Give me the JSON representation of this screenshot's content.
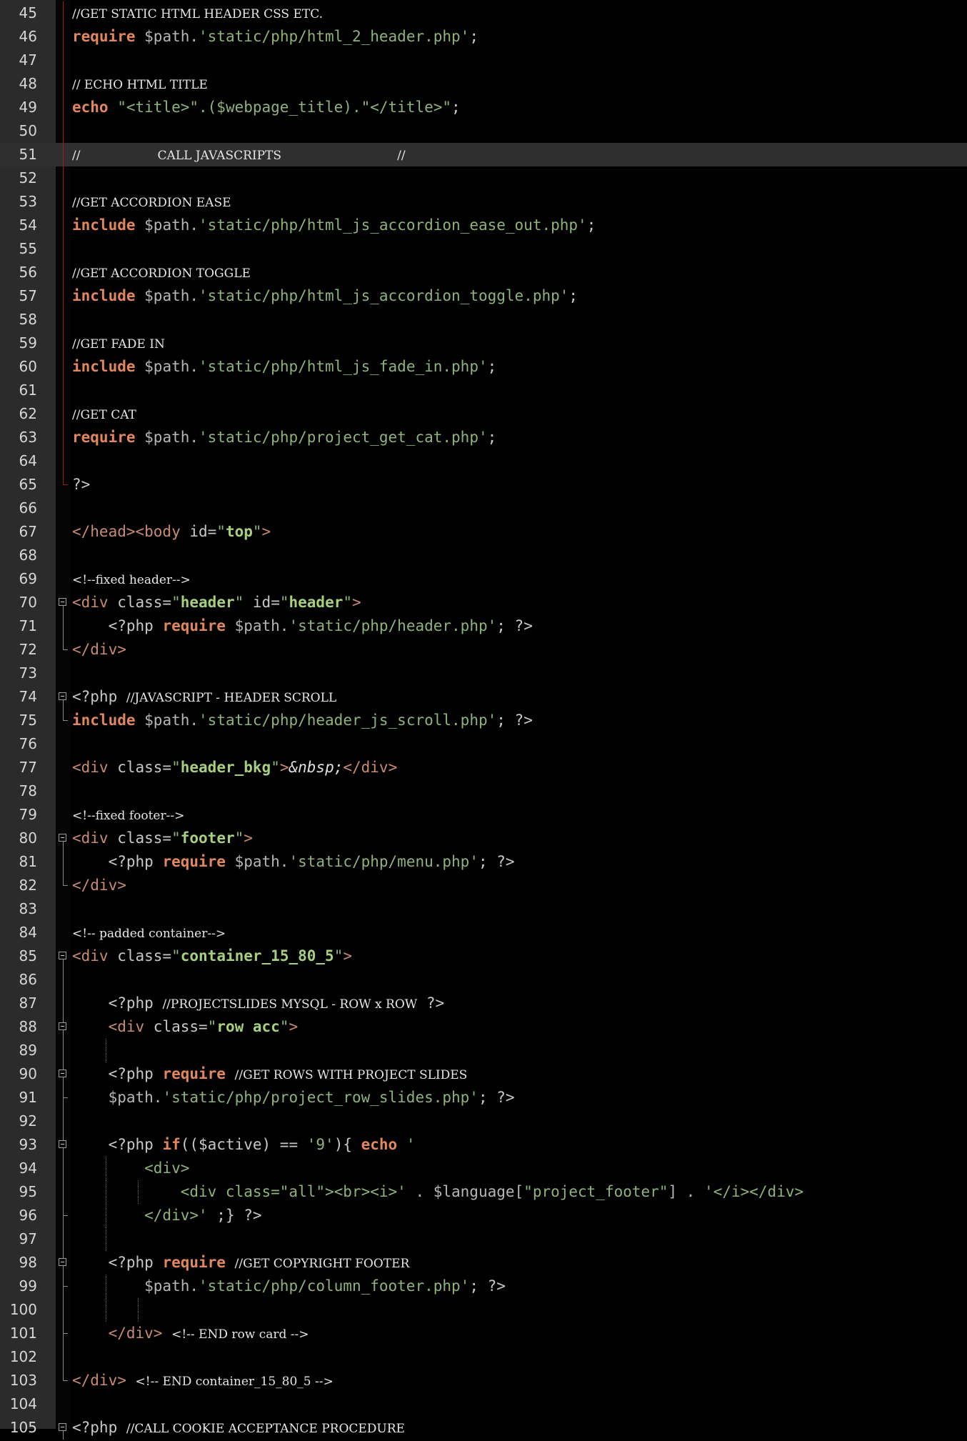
{
  "editor": {
    "colors": {
      "background": "#000000",
      "gutter": "#2b2b2b",
      "keyword": "#e0875f",
      "string": "#8fb27a",
      "tag": "#c98a73",
      "change_marker": "#a11b1b"
    },
    "lines": [
      {
        "num": "45",
        "fold": "red",
        "tokens": [
          {
            "t": "//GET STATIC HTML HEADER CSS ETC.",
            "c": "cmt"
          }
        ]
      },
      {
        "num": "46",
        "fold": "red",
        "tokens": [
          {
            "t": "require",
            "c": "kw"
          },
          {
            "t": " $path.",
            "c": "var"
          },
          {
            "t": "'static/php/html_2_header.php'",
            "c": "str"
          },
          {
            "t": ";",
            "c": "plain"
          }
        ]
      },
      {
        "num": "47",
        "fold": "red",
        "tokens": []
      },
      {
        "num": "48",
        "fold": "red",
        "tokens": [
          {
            "t": "// ECHO HTML TITLE",
            "c": "cmt"
          }
        ]
      },
      {
        "num": "49",
        "fold": "red",
        "tokens": [
          {
            "t": "echo",
            "c": "kw"
          },
          {
            "t": " \"<title>\".($webpage_title).\"</title>\"",
            "c": "str"
          },
          {
            "t": ";",
            "c": "plain"
          }
        ]
      },
      {
        "num": "50",
        "fold": "red",
        "tokens": []
      },
      {
        "num": "51",
        "fold": "red",
        "hl": true,
        "tokens": [
          {
            "t": "//                    CALL JAVASCRIPTS                              //",
            "c": "cmt"
          }
        ]
      },
      {
        "num": "52",
        "fold": "red",
        "tokens": []
      },
      {
        "num": "53",
        "fold": "red",
        "tokens": [
          {
            "t": "//GET ACCORDION EASE",
            "c": "cmt"
          }
        ]
      },
      {
        "num": "54",
        "fold": "red",
        "tokens": [
          {
            "t": "include",
            "c": "kw"
          },
          {
            "t": " $path.",
            "c": "var"
          },
          {
            "t": "'static/php/html_js_accordion_ease_out.php'",
            "c": "str"
          },
          {
            "t": ";",
            "c": "plain"
          }
        ]
      },
      {
        "num": "55",
        "fold": "red",
        "tokens": []
      },
      {
        "num": "56",
        "fold": "red",
        "tokens": [
          {
            "t": "//GET ACCORDION TOGGLE",
            "c": "cmt"
          }
        ]
      },
      {
        "num": "57",
        "fold": "red",
        "tokens": [
          {
            "t": "include",
            "c": "kw"
          },
          {
            "t": " $path.",
            "c": "var"
          },
          {
            "t": "'static/php/html_js_accordion_toggle.php'",
            "c": "str"
          },
          {
            "t": ";",
            "c": "plain"
          }
        ]
      },
      {
        "num": "58",
        "fold": "red",
        "tokens": []
      },
      {
        "num": "59",
        "fold": "red",
        "tokens": [
          {
            "t": "//GET FADE IN",
            "c": "cmt"
          }
        ]
      },
      {
        "num": "60",
        "fold": "red",
        "tokens": [
          {
            "t": "include",
            "c": "kw"
          },
          {
            "t": " $path.",
            "c": "var"
          },
          {
            "t": "'static/php/html_js_fade_in.php'",
            "c": "str"
          },
          {
            "t": ";",
            "c": "plain"
          }
        ]
      },
      {
        "num": "61",
        "fold": "red",
        "tokens": []
      },
      {
        "num": "62",
        "fold": "red",
        "tokens": [
          {
            "t": "//GET CAT",
            "c": "cmt"
          }
        ]
      },
      {
        "num": "63",
        "fold": "red",
        "tokens": [
          {
            "t": "require",
            "c": "kw"
          },
          {
            "t": " $path.",
            "c": "var"
          },
          {
            "t": "'static/php/project_get_cat.php'",
            "c": "str"
          },
          {
            "t": ";",
            "c": "plain"
          }
        ]
      },
      {
        "num": "64",
        "fold": "red",
        "tokens": []
      },
      {
        "num": "65",
        "fold": "redend",
        "tokens": [
          {
            "t": "?>",
            "c": "php"
          }
        ]
      },
      {
        "num": "66",
        "tokens": []
      },
      {
        "num": "67",
        "tokens": [
          {
            "t": "</head><body",
            "c": "tag"
          },
          {
            "t": " id=",
            "c": "plain"
          },
          {
            "t": "\"",
            "c": "str"
          },
          {
            "t": "top",
            "c": "strb"
          },
          {
            "t": "\"",
            "c": "str"
          },
          {
            "t": ">",
            "c": "tag"
          }
        ]
      },
      {
        "num": "68",
        "tokens": []
      },
      {
        "num": "69",
        "tokens": [
          {
            "t": "<!--fixed header-->",
            "c": "cmt"
          }
        ]
      },
      {
        "num": "70",
        "fold": "start",
        "tokens": [
          {
            "t": "<div",
            "c": "tag"
          },
          {
            "t": " class=",
            "c": "plain"
          },
          {
            "t": "\"",
            "c": "str"
          },
          {
            "t": "header",
            "c": "strb"
          },
          {
            "t": "\"",
            "c": "str"
          },
          {
            "t": " id=",
            "c": "plain"
          },
          {
            "t": "\"",
            "c": "str"
          },
          {
            "t": "header",
            "c": "strb"
          },
          {
            "t": "\"",
            "c": "str"
          },
          {
            "t": ">",
            "c": "tag"
          }
        ]
      },
      {
        "num": "71",
        "fold": "mid",
        "tokens": [
          {
            "t": "    <?php ",
            "c": "php"
          },
          {
            "t": "require",
            "c": "kw"
          },
          {
            "t": " $path.",
            "c": "var"
          },
          {
            "t": "'static/php/header.php'",
            "c": "str"
          },
          {
            "t": "; ?>",
            "c": "php"
          }
        ]
      },
      {
        "num": "72",
        "fold": "end",
        "tokens": [
          {
            "t": "</div>",
            "c": "tag"
          }
        ]
      },
      {
        "num": "73",
        "tokens": []
      },
      {
        "num": "74",
        "fold": "start",
        "tokens": [
          {
            "t": "<?php ",
            "c": "php"
          },
          {
            "t": "//JAVASCRIPT - HEADER SCROLL",
            "c": "cmt"
          }
        ]
      },
      {
        "num": "75",
        "fold": "end",
        "tokens": [
          {
            "t": "include",
            "c": "kw"
          },
          {
            "t": " $path.",
            "c": "var"
          },
          {
            "t": "'static/php/header_js_scroll.php'",
            "c": "str"
          },
          {
            "t": "; ?>",
            "c": "php"
          }
        ]
      },
      {
        "num": "76",
        "tokens": []
      },
      {
        "num": "77",
        "tokens": [
          {
            "t": "<div",
            "c": "tag"
          },
          {
            "t": " class=",
            "c": "plain"
          },
          {
            "t": "\"",
            "c": "str"
          },
          {
            "t": "header_bkg",
            "c": "strb"
          },
          {
            "t": "\"",
            "c": "str"
          },
          {
            "t": ">",
            "c": "tag"
          },
          {
            "t": "&nbsp;",
            "c": "ent"
          },
          {
            "t": "</div>",
            "c": "tag"
          }
        ]
      },
      {
        "num": "78",
        "tokens": []
      },
      {
        "num": "79",
        "tokens": [
          {
            "t": "<!--fixed footer-->",
            "c": "cmt"
          }
        ]
      },
      {
        "num": "80",
        "fold": "start",
        "tokens": [
          {
            "t": "<div",
            "c": "tag"
          },
          {
            "t": " class=",
            "c": "plain"
          },
          {
            "t": "\"",
            "c": "str"
          },
          {
            "t": "footer",
            "c": "strb"
          },
          {
            "t": "\"",
            "c": "str"
          },
          {
            "t": ">",
            "c": "tag"
          }
        ]
      },
      {
        "num": "81",
        "fold": "mid",
        "tokens": [
          {
            "t": "    <?php ",
            "c": "php"
          },
          {
            "t": "require",
            "c": "kw"
          },
          {
            "t": " $path.",
            "c": "var"
          },
          {
            "t": "'static/php/menu.php'",
            "c": "str"
          },
          {
            "t": "; ?>",
            "c": "php"
          }
        ]
      },
      {
        "num": "82",
        "fold": "end",
        "tokens": [
          {
            "t": "</div>",
            "c": "tag"
          }
        ]
      },
      {
        "num": "83",
        "tokens": []
      },
      {
        "num": "84",
        "tokens": [
          {
            "t": "<!-- padded container-->",
            "c": "cmt"
          }
        ]
      },
      {
        "num": "85",
        "fold": "start",
        "tokens": [
          {
            "t": "<div",
            "c": "tag"
          },
          {
            "t": " class=",
            "c": "plain"
          },
          {
            "t": "\"",
            "c": "str"
          },
          {
            "t": "container_15_80_5",
            "c": "strb"
          },
          {
            "t": "\"",
            "c": "str"
          },
          {
            "t": ">",
            "c": "tag"
          }
        ]
      },
      {
        "num": "86",
        "fold": "mid",
        "tokens": []
      },
      {
        "num": "87",
        "fold": "mid",
        "tokens": [
          {
            "t": "    <?php ",
            "c": "php"
          },
          {
            "t": "//PROJECTSLIDES MYSQL - ROW x ROW",
            "c": "cmt"
          },
          {
            "t": " ?>",
            "c": "php"
          }
        ]
      },
      {
        "num": "88",
        "fold": "startin",
        "tokens": [
          {
            "t": "    <div",
            "c": "tag"
          },
          {
            "t": " class=",
            "c": "plain"
          },
          {
            "t": "\"",
            "c": "str"
          },
          {
            "t": "row acc",
            "c": "strb"
          },
          {
            "t": "\"",
            "c": "str"
          },
          {
            "t": ">",
            "c": "tag"
          }
        ]
      },
      {
        "num": "89",
        "fold": "mid",
        "guides": [
          1
        ],
        "tokens": []
      },
      {
        "num": "90",
        "fold": "startin",
        "tokens": [
          {
            "t": "    <?php ",
            "c": "php"
          },
          {
            "t": "require",
            "c": "kw"
          },
          {
            "t": " ",
            "c": "plain"
          },
          {
            "t": "//GET ROWS WITH PROJECT SLIDES",
            "c": "cmt"
          }
        ]
      },
      {
        "num": "91",
        "fold": "tick",
        "tokens": [
          {
            "t": "    $path.",
            "c": "var"
          },
          {
            "t": "'static/php/project_row_slides.php'",
            "c": "str"
          },
          {
            "t": "; ?>",
            "c": "php"
          }
        ]
      },
      {
        "num": "92",
        "fold": "mid",
        "tokens": []
      },
      {
        "num": "93",
        "fold": "startin",
        "tokens": [
          {
            "t": "    <?php ",
            "c": "php"
          },
          {
            "t": "if",
            "c": "kw"
          },
          {
            "t": "(($active) == ",
            "c": "plain"
          },
          {
            "t": "'9'",
            "c": "str"
          },
          {
            "t": "){ ",
            "c": "plain"
          },
          {
            "t": "echo",
            "c": "kw"
          },
          {
            "t": " '",
            "c": "str"
          }
        ]
      },
      {
        "num": "94",
        "fold": "mid",
        "guides": [
          1
        ],
        "tokens": [
          {
            "t": "        <div>",
            "c": "str"
          }
        ]
      },
      {
        "num": "95",
        "fold": "mid",
        "guides": [
          1,
          2
        ],
        "tokens": [
          {
            "t": "            <div class=\"all\"><br><i>'",
            "c": "str"
          },
          {
            "t": " . $language[",
            "c": "var"
          },
          {
            "t": "\"project_footer\"",
            "c": "str"
          },
          {
            "t": "] . ",
            "c": "var"
          },
          {
            "t": "'</i></div>",
            "c": "str"
          }
        ]
      },
      {
        "num": "96",
        "fold": "tick",
        "guides": [
          1
        ],
        "tokens": [
          {
            "t": "        </div>'",
            "c": "str"
          },
          {
            "t": " ;} ?>",
            "c": "php"
          }
        ]
      },
      {
        "num": "97",
        "fold": "mid",
        "guides": [
          1
        ],
        "tokens": []
      },
      {
        "num": "98",
        "fold": "startin",
        "tokens": [
          {
            "t": "    <?php ",
            "c": "php"
          },
          {
            "t": "require",
            "c": "kw"
          },
          {
            "t": " ",
            "c": "plain"
          },
          {
            "t": "//GET COPYRIGHT FOOTER",
            "c": "cmt"
          }
        ]
      },
      {
        "num": "99",
        "fold": "tick",
        "guides": [
          1
        ],
        "tokens": [
          {
            "t": "        $path.",
            "c": "var"
          },
          {
            "t": "'static/php/column_footer.php'",
            "c": "str"
          },
          {
            "t": "; ?>",
            "c": "php"
          }
        ]
      },
      {
        "num": "100",
        "fold": "mid",
        "guides": [
          1,
          2
        ],
        "tokens": []
      },
      {
        "num": "101",
        "fold": "tick",
        "tokens": [
          {
            "t": "    </div>",
            "c": "tag"
          },
          {
            "t": " ",
            "c": "plain"
          },
          {
            "t": "<!-- END row card -->",
            "c": "cmt"
          }
        ]
      },
      {
        "num": "102",
        "fold": "mid",
        "tokens": []
      },
      {
        "num": "103",
        "fold": "end",
        "tokens": [
          {
            "t": "</div>",
            "c": "tag"
          },
          {
            "t": " ",
            "c": "plain"
          },
          {
            "t": "<!-- END container_15_80_5 -->",
            "c": "cmt"
          }
        ]
      },
      {
        "num": "104",
        "tokens": []
      },
      {
        "num": "105",
        "fold": "start",
        "tokens": [
          {
            "t": "<?php ",
            "c": "php"
          },
          {
            "t": "//CALL COOKIE ACCEPTANCE PROCEDURE",
            "c": "cmt"
          }
        ]
      }
    ]
  }
}
